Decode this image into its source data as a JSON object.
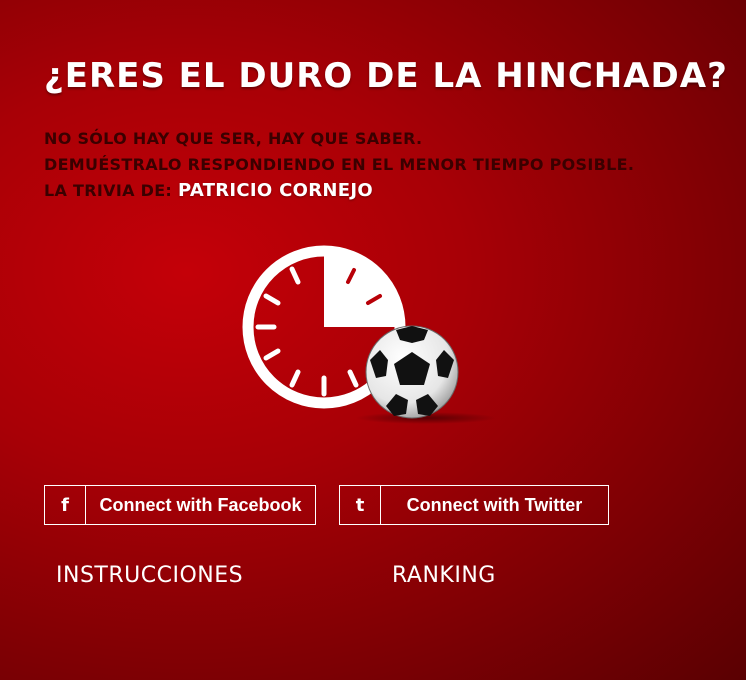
{
  "header": {
    "title": "¿ERES EL DURO DE LA HINCHADA?"
  },
  "intro": {
    "line1": "NO SÓLO HAY QUE SER, HAY QUE SABER.",
    "line2": "DEMUÉSTRALO RESPONDIENDO EN EL MENOR TIEMPO POSIBLE.",
    "trivia_prefix": "LA TRIVIA DE: ",
    "trivia_author": "PATRICIO CORNEJO"
  },
  "hero": {
    "icons": [
      "stopwatch-icon",
      "soccer-ball-icon"
    ]
  },
  "actions": {
    "facebook": {
      "icon_glyph": "f",
      "icon": "facebook-icon",
      "label": "Connect with Facebook"
    },
    "twitter": {
      "icon_glyph": "t",
      "icon": "twitter-icon",
      "label": "Connect with Twitter"
    }
  },
  "links": {
    "instructions": "INSTRUCCIONES",
    "ranking": "RANKING"
  },
  "colors": {
    "background": "#a80006",
    "intro_text": "#3a0000",
    "accent_white": "#ffffff"
  }
}
